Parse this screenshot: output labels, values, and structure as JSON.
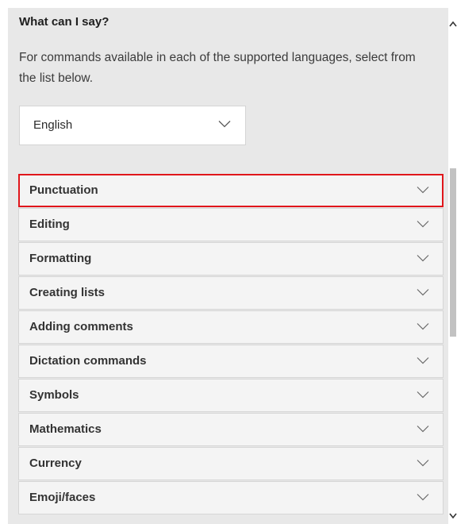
{
  "panel": {
    "title": "What can I say?",
    "description": "For commands available in each of the supported languages, select from the list below."
  },
  "language_select": {
    "selected": "English",
    "icon": "chevron-down-icon"
  },
  "sections": [
    {
      "label": "Punctuation",
      "icon": "chevron-down-icon",
      "highlighted": true
    },
    {
      "label": "Editing",
      "icon": "chevron-down-icon"
    },
    {
      "label": "Formatting",
      "icon": "chevron-down-icon"
    },
    {
      "label": "Creating lists",
      "icon": "chevron-down-icon"
    },
    {
      "label": "Adding comments",
      "icon": "chevron-down-icon"
    },
    {
      "label": "Dictation commands",
      "icon": "chevron-down-icon"
    },
    {
      "label": "Symbols",
      "icon": "chevron-down-icon"
    },
    {
      "label": "Mathematics",
      "icon": "chevron-down-icon"
    },
    {
      "label": "Currency",
      "icon": "chevron-down-icon"
    },
    {
      "label": "Emoji/faces",
      "icon": "chevron-down-icon"
    }
  ],
  "colors": {
    "panel_background": "#e8e8e8",
    "row_background": "#f4f4f4",
    "highlight_border": "#e0161b"
  }
}
